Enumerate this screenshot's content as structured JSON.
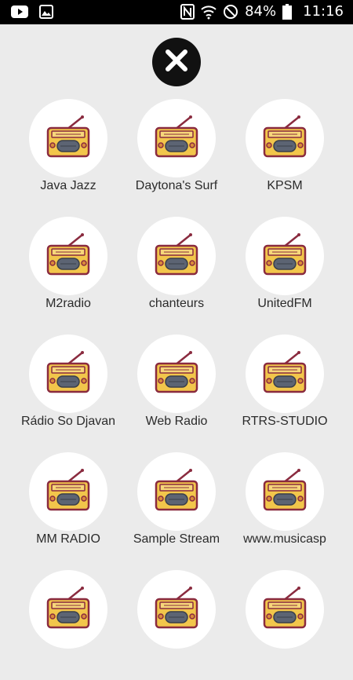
{
  "status_bar": {
    "battery": "84%",
    "time": "11:16",
    "left_icons": [
      "youtube-icon",
      "gallery-icon"
    ],
    "right_icons": [
      "nfc-icon",
      "wifi-icon",
      "do-not-disturb-icon",
      "battery-icon"
    ]
  },
  "close_button": {
    "icon": "close-icon"
  },
  "stations": [
    {
      "label": "Java Jazz"
    },
    {
      "label": "Daytona's Surf"
    },
    {
      "label": "KPSM"
    },
    {
      "label": "M2radio"
    },
    {
      "label": "chanteurs"
    },
    {
      "label": "UnitedFM"
    },
    {
      "label": "Rádio So Djavan"
    },
    {
      "label": "Web Radio"
    },
    {
      "label": "RTRS-STUDIO"
    },
    {
      "label": "MM RADIO"
    },
    {
      "label": "Sample Stream"
    },
    {
      "label": "www.musicasp"
    },
    {
      "label": ""
    },
    {
      "label": ""
    },
    {
      "label": ""
    }
  ],
  "colors": {
    "background": "#ebebeb",
    "radio_body": "#f2c64b",
    "radio_outline": "#8a2b3f",
    "radio_speaker": "#5c6473"
  }
}
